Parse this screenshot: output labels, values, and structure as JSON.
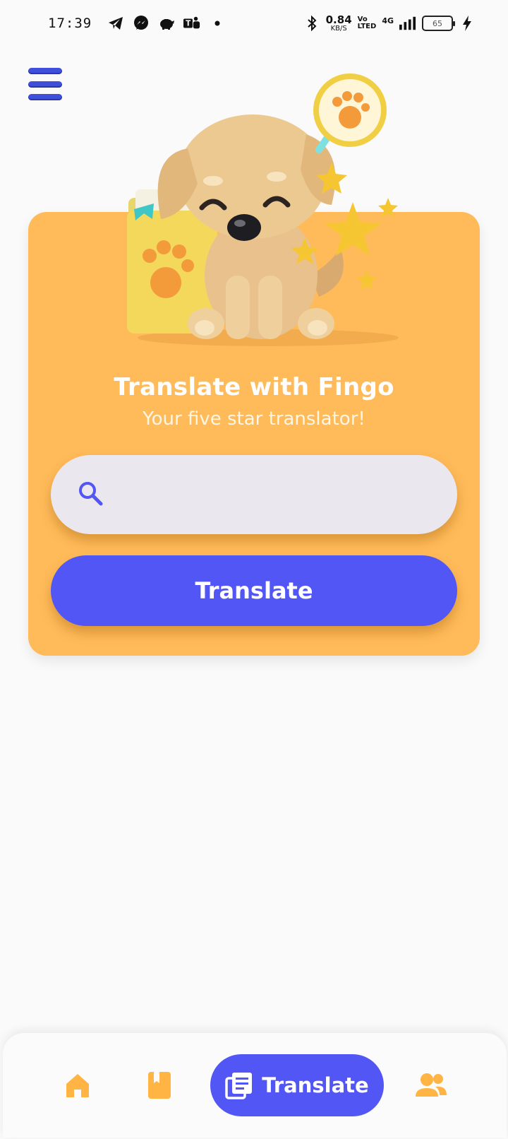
{
  "status_bar": {
    "time": "17:39",
    "net_speed_value": "0.84",
    "net_speed_unit": "KB/S",
    "volte_top": "Vo",
    "volte_bottom": "LTED",
    "network": "4G",
    "battery": "65"
  },
  "menu": {
    "icon": "hamburger-menu-icon"
  },
  "card": {
    "title": "Translate with Fingo",
    "subtitle": "Your five star translator!",
    "search": {
      "value": "",
      "placeholder": "",
      "icon": "search-icon"
    },
    "translate_button": "Translate"
  },
  "bottom_nav": {
    "items": [
      {
        "icon": "home-icon",
        "label": ""
      },
      {
        "icon": "book-icon",
        "label": ""
      },
      {
        "icon": "translate-icon",
        "label": "Translate",
        "active": true
      },
      {
        "icon": "users-icon",
        "label": ""
      }
    ]
  },
  "colors": {
    "card_background": "#ffba59",
    "accent": "#5156f5",
    "nav_icon": "#ffb444",
    "search_background": "#ebe7ef"
  }
}
